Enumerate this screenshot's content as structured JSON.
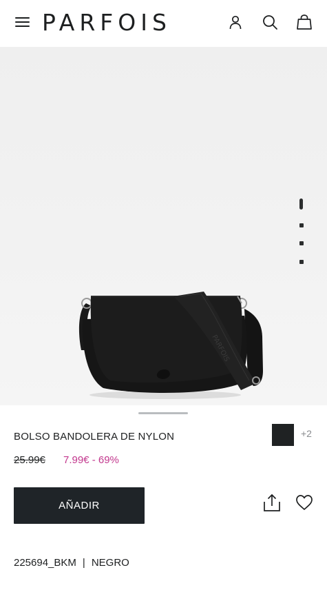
{
  "header": {
    "brand": "PARFOIS",
    "menu_icon": "hamburger-menu-icon",
    "account_icon": "user-icon",
    "search_icon": "search-icon",
    "bag_icon": "shopping-bag-icon"
  },
  "gallery": {
    "image_alt": "BOLSO BANDOLERA DE NYLON",
    "slides_total": 4,
    "active_slide": 1,
    "strap_text": "PARFOIS"
  },
  "product": {
    "name": "BOLSO BANDOLERA DE NYLON",
    "old_price": "25.99€",
    "new_price": "7.99€ - 69%",
    "more_colors": "+2",
    "swatch_color": "#1f2223",
    "price_color": "#c2378d"
  },
  "actions": {
    "add_label": "AÑADIR",
    "share_icon": "share-icon",
    "wishlist_icon": "heart-icon"
  },
  "reference": {
    "code": "225694_BKM",
    "separator": "|",
    "color": "NEGRO"
  }
}
